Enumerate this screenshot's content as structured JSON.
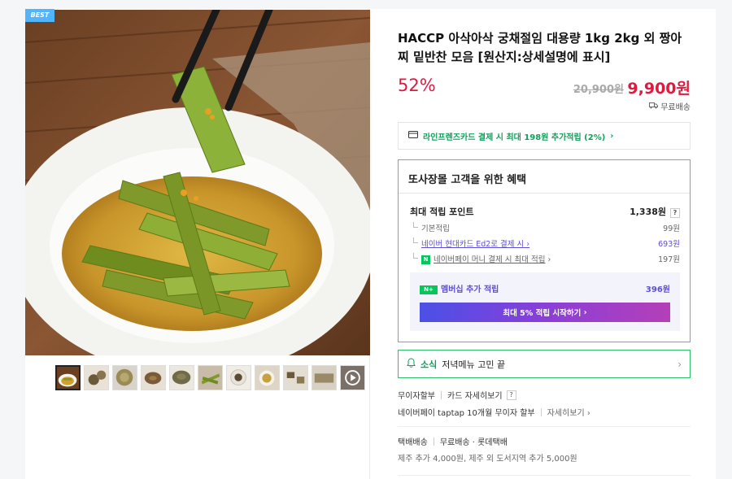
{
  "badge": "BEST",
  "product": {
    "title": "HACCP 아삭아삭 궁채절임 대용량 1kg 2kg 외 짱아찌 밑반찬 모음 [원산지:상세설명에 표시]",
    "discount": "52%",
    "original_price": "20,900원",
    "sale_price": "9,900원",
    "shipping_label": "무료배송"
  },
  "card_promo": "라인프렌즈카드 결제 시 최대 198원 추가적립 (2%)",
  "benefits": {
    "heading": "또사장몰 고객을 위한 혜택",
    "max_point_label": "최대 적립 포인트",
    "max_point_value": "1,338원",
    "rows": [
      {
        "label": "기본적립",
        "value": "99원"
      },
      {
        "label": "네이버 현대카드 Ed2로 결제 시",
        "value": "693원"
      },
      {
        "label": "네이버페이 머니 결제 시 최대 적립",
        "value": "197원",
        "badge": "N"
      }
    ],
    "membership_label": "멤버십 추가 적립",
    "membership_value": "396원",
    "membership_button": "최대 5% 적립 시작하기"
  },
  "soshik": {
    "brand": "소식",
    "text": "저녁메뉴 고민 끝"
  },
  "payment": {
    "installment_label": "무이자할부",
    "card_detail": "카드 자세히보기",
    "taptap": "네이버페이 taptap 10개월 무이자 할부",
    "taptap_detail": "자세히보기"
  },
  "delivery": {
    "type": "택배배송",
    "fee": "무료배송 · 롯데택배",
    "extra": "제주 추가 4,000원, 제주 외 도서지역 추가 5,000원"
  },
  "colors": {
    "accent_red": "#e0193e",
    "naver_green": "#11a05a",
    "purple": "#5d4fd6"
  }
}
